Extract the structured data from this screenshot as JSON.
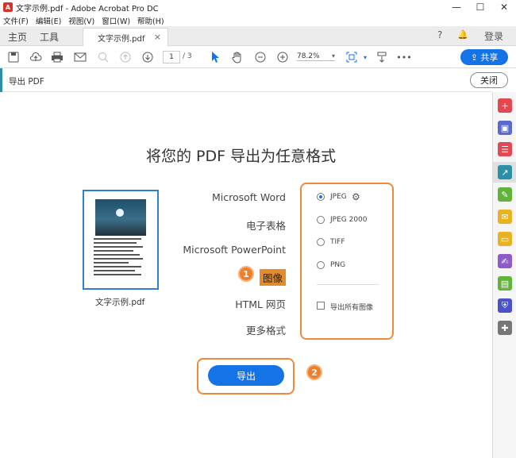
{
  "window": {
    "title": "文字示例.pdf - Adobe Acrobat Pro DC",
    "app_icon": "A",
    "controls": [
      "—",
      "☐",
      "✕"
    ]
  },
  "menu": [
    "文件(F)",
    "编辑(E)",
    "视图(V)",
    "窗口(W)",
    "帮助(H)"
  ],
  "tabs": {
    "home": "主页",
    "tools": "工具",
    "doc": "文字示例.pdf",
    "close": "×"
  },
  "tab_right": {
    "help": "?",
    "bell": "🔔",
    "login": "登录"
  },
  "toolbar": {
    "page_current": "1",
    "page_total": "/ 3",
    "zoom": "78.2%",
    "more": "•••",
    "share_label": "⇪ 共享"
  },
  "panel": {
    "title": "导出 PDF",
    "close_label": "关闭"
  },
  "main": {
    "heading": "将您的 PDF 导出为任意格式",
    "thumbnail_label": "文字示例.pdf",
    "formats": [
      "Microsoft Word",
      "电子表格",
      "Microsoft PowerPoint",
      "图像",
      "HTML 网页",
      "更多格式"
    ],
    "selected_format": "图像",
    "options": [
      "JPEG",
      "JPEG 2000",
      "TIFF",
      "PNG"
    ],
    "selected_option": "JPEG",
    "export_all_images": "导出所有图像",
    "export_button": "导出"
  },
  "annotations": {
    "badge1": "1",
    "badge2": "2"
  },
  "colors": {
    "accent": "#1473e6",
    "highlight": "#ef8a3c",
    "panel_accent": "#2d8fa6"
  }
}
